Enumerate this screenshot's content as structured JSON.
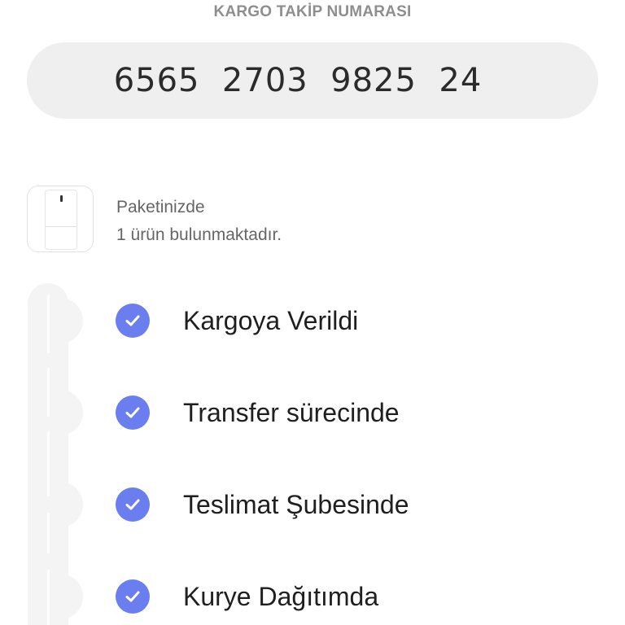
{
  "header": {
    "tracking_label": "KARGO TAKİP NUMARASI",
    "tracking_number": "6565  2703  9825  24"
  },
  "package": {
    "line1": "Paketinizde",
    "line2": "1 ürün bulunmaktadır."
  },
  "steps": [
    {
      "label": "Kargoya Verildi",
      "icon": "check-icon"
    },
    {
      "label": "Transfer sürecinde",
      "icon": "check-icon"
    },
    {
      "label": "Teslimat Şubesinde",
      "icon": "check-icon"
    },
    {
      "label": "Kurye Dağıtımda",
      "icon": "check-icon"
    }
  ],
  "colors": {
    "accent": "#6b7ef0",
    "track": "#f4f4f4",
    "number_box": "#efefef"
  }
}
